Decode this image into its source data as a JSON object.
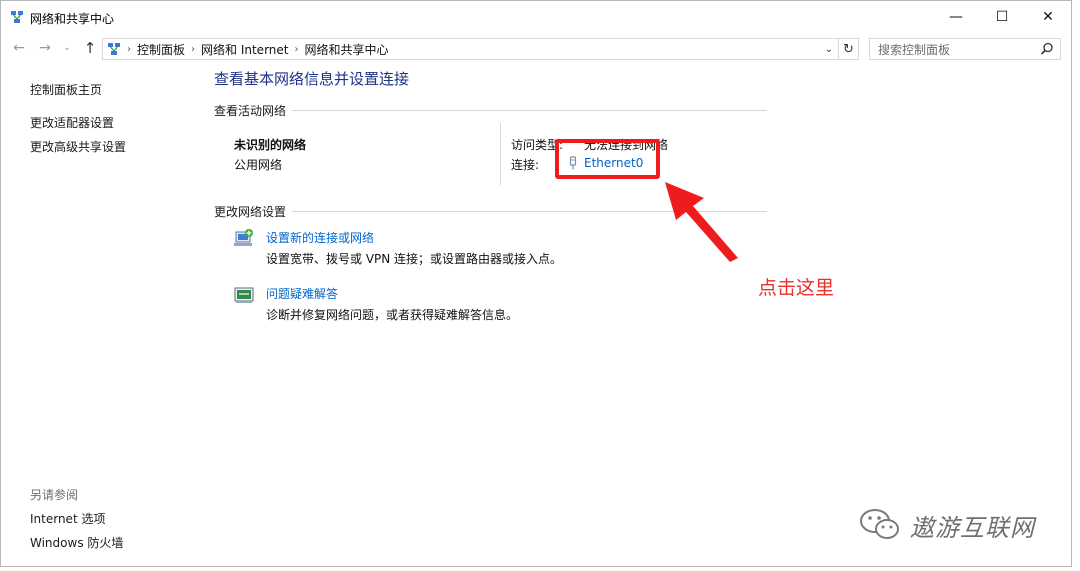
{
  "window": {
    "title": "网络和共享中心",
    "controls": {
      "minimize": "—",
      "maximize": "☐",
      "close": "✕"
    }
  },
  "nav": {
    "back": "←",
    "forward": "→",
    "recent": "⌄",
    "up": "↑",
    "breadcrumbs": [
      "控制面板",
      "网络和 Internet",
      "网络和共享中心"
    ],
    "separator": "›",
    "dropdown": "⌄",
    "refresh": "↻",
    "search_placeholder": "搜索控制面板"
  },
  "sidebar": {
    "links": [
      "控制面板主页",
      "更改适配器设置",
      "更改高级共享设置"
    ],
    "see_also_title": "另请参阅",
    "see_also_links": [
      "Internet 选项",
      "Windows 防火墙"
    ]
  },
  "main": {
    "title": "查看基本网络信息并设置连接",
    "active_section": "查看活动网络",
    "network": {
      "name": "未识别的网络",
      "type": "公用网络",
      "access_label": "访问类型:",
      "access_value": "无法连接到网络",
      "connection_label": "连接:",
      "connection_value": "Ethernet0"
    },
    "change_section": "更改网络设置",
    "tasks": [
      {
        "link": "设置新的连接或网络",
        "desc": "设置宽带、拨号或 VPN 连接；或设置路由器或接入点。"
      },
      {
        "link": "问题疑难解答",
        "desc": "诊断并修复网络问题，或者获得疑难解答信息。"
      }
    ]
  },
  "annotation": {
    "text": "点击这里",
    "color": "#ee1c1c"
  },
  "watermark": {
    "text": "遨游互联网"
  },
  "colors": {
    "link": "#0066cc",
    "title": "#1e3287",
    "annotation": "#e8322b"
  }
}
